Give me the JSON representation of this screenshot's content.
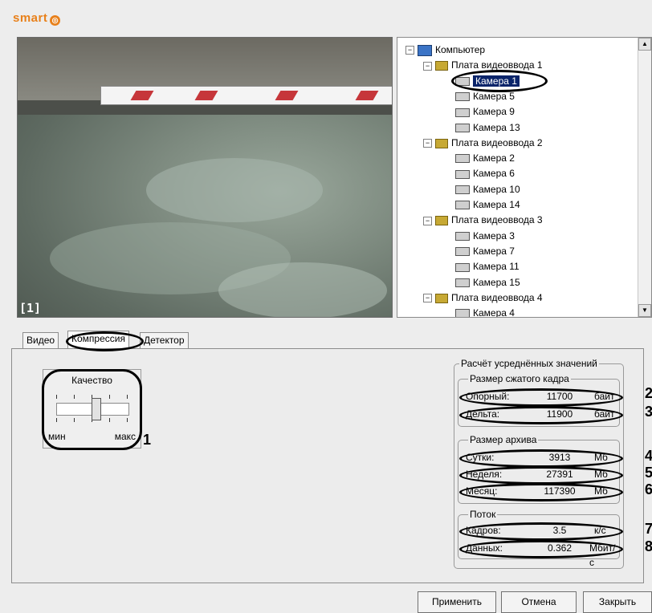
{
  "app": {
    "logo_text": "smart"
  },
  "video": {
    "camera_index": "[1]"
  },
  "tree": {
    "root": "Компьютер",
    "boards": [
      {
        "label": "Плата видеоввода 1",
        "cameras": [
          "Камера 1",
          "Камера 5",
          "Камера 9",
          "Камера 13"
        ]
      },
      {
        "label": "Плата видеоввода 2",
        "cameras": [
          "Камера 2",
          "Камера 6",
          "Камера 10",
          "Камера 14"
        ]
      },
      {
        "label": "Плата видеоввода 3",
        "cameras": [
          "Камера 3",
          "Камера 7",
          "Камера 11",
          "Камера 15"
        ]
      },
      {
        "label": "Плата видеоввода 4",
        "cameras": [
          "Камера 4"
        ]
      }
    ],
    "selected": "Камера 1"
  },
  "tabs": {
    "video": "Видео",
    "compression": "Компрессия",
    "detector": "Детектор"
  },
  "quality": {
    "title": "Качество",
    "min": "мин",
    "max": "макс",
    "level": 0.55
  },
  "averages": {
    "title": "Расчёт усреднённых значений",
    "frame_size": {
      "title": "Размер сжатого кадра",
      "rows": [
        {
          "label": "Опорный:",
          "value": "11700",
          "unit": "байт"
        },
        {
          "label": "Дельта:",
          "value": "11900",
          "unit": "байт"
        }
      ]
    },
    "archive_size": {
      "title": "Размер архива",
      "rows": [
        {
          "label": "Сутки:",
          "value": "3913",
          "unit": "Мб"
        },
        {
          "label": "Неделя:",
          "value": "27391",
          "unit": "Мб"
        },
        {
          "label": "Месяц:",
          "value": "117390",
          "unit": "Мб"
        }
      ]
    },
    "stream": {
      "title": "Поток",
      "rows": [
        {
          "label": "Кадров:",
          "value": "3.5",
          "unit": "к/с"
        },
        {
          "label": "Данных:",
          "value": "0.362",
          "unit": "Мбит/с"
        }
      ]
    }
  },
  "markers": [
    "1",
    "2",
    "3",
    "4",
    "5",
    "6",
    "7",
    "8"
  ],
  "buttons": {
    "apply": "Применить",
    "cancel": "Отмена",
    "close": "Закрыть"
  }
}
